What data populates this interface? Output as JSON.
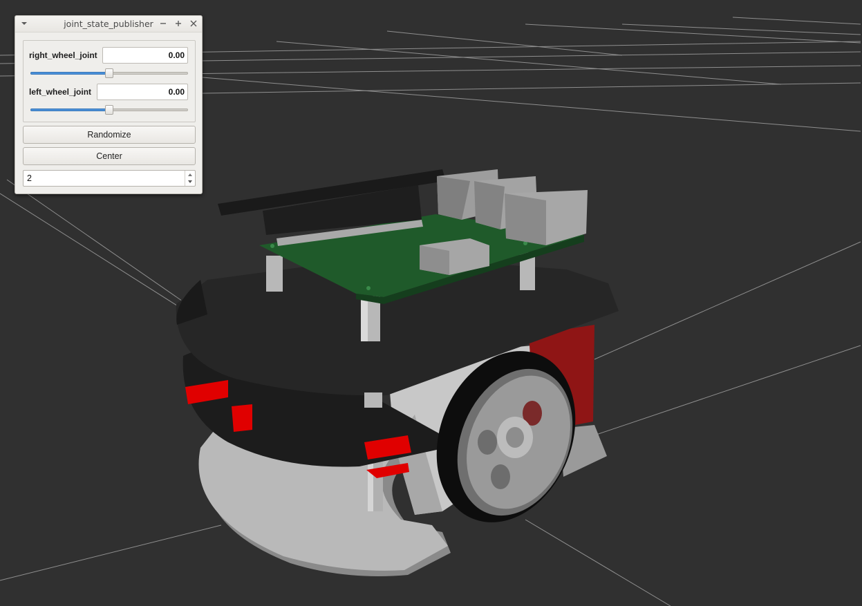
{
  "window": {
    "title": "joint_state_publisher",
    "menu_icon": "chevron-down-icon",
    "minimize_icon": "minimize-icon",
    "maximize_icon": "plus-icon",
    "close_icon": "close-icon"
  },
  "joints": [
    {
      "label": "right_wheel_joint",
      "value": "0.00",
      "slider_fraction": 0.5
    },
    {
      "label": "left_wheel_joint",
      "value": "0.00",
      "slider_fraction": 0.5
    }
  ],
  "buttons": {
    "randomize": "Randomize",
    "center": "Center"
  },
  "spinbox": {
    "value": "2"
  },
  "colors": {
    "viewport_bg": "#303030",
    "grid": "#a0a0a0",
    "slider_fill": "#4a90d9",
    "robot_plate": "#232323",
    "pcb": "#1f5a2a",
    "sensor_red": "#e00000"
  }
}
